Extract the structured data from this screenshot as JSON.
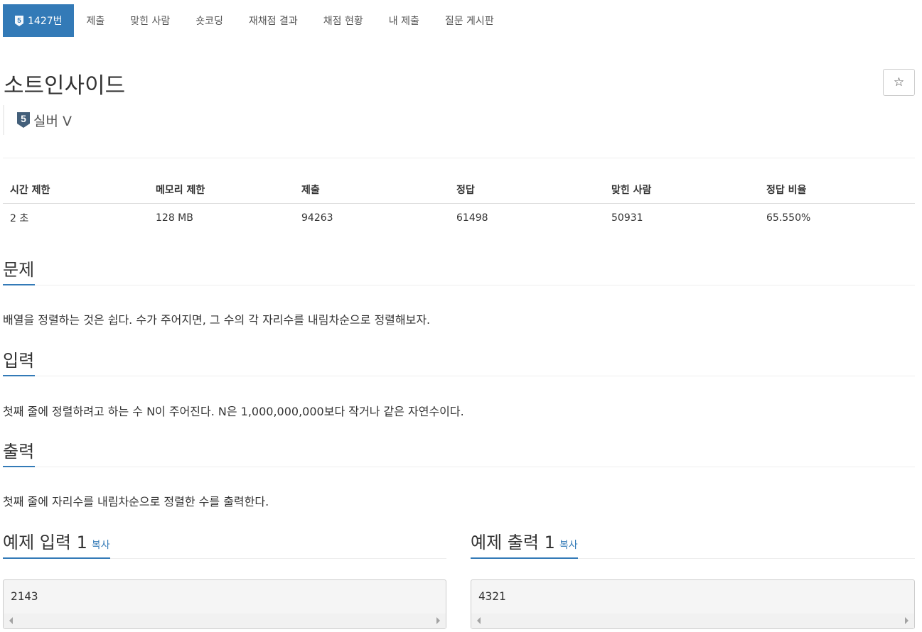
{
  "nav": {
    "problem_tab": "1427번",
    "tier_badge": "5",
    "items": [
      "제출",
      "맞힌 사람",
      "숏코딩",
      "재채점 결과",
      "채점 현황",
      "내 제출",
      "질문 게시판"
    ]
  },
  "problem": {
    "title": "소트인사이드",
    "star_icon": "☆",
    "tier_number": "5",
    "tier_label": "실버 V"
  },
  "info": {
    "headers": [
      "시간 제한",
      "메모리 제한",
      "제출",
      "정답",
      "맞힌 사람",
      "정답 비율"
    ],
    "values": [
      "2 초",
      "128 MB",
      "94263",
      "61498",
      "50931",
      "65.550%"
    ]
  },
  "sections": {
    "description": {
      "title": "문제",
      "text": "배열을 정렬하는 것은 쉽다. 수가 주어지면, 그 수의 각 자리수를 내림차순으로 정렬해보자."
    },
    "input": {
      "title": "입력",
      "text": "첫째 줄에 정렬하려고 하는 수 N이 주어진다. N은 1,000,000,000보다 작거나 같은 자연수이다."
    },
    "output": {
      "title": "출력",
      "text": "첫째 줄에 자리수를 내림차순으로 정렬한 수를 출력한다."
    }
  },
  "samples": {
    "input": {
      "title": "예제 입력 1",
      "copy": "복사",
      "content": "2143"
    },
    "output": {
      "title": "예제 출력 1",
      "copy": "복사",
      "content": "4321"
    }
  },
  "colors": {
    "accent": "#337ab7",
    "tier_silver": "#435f7a"
  }
}
